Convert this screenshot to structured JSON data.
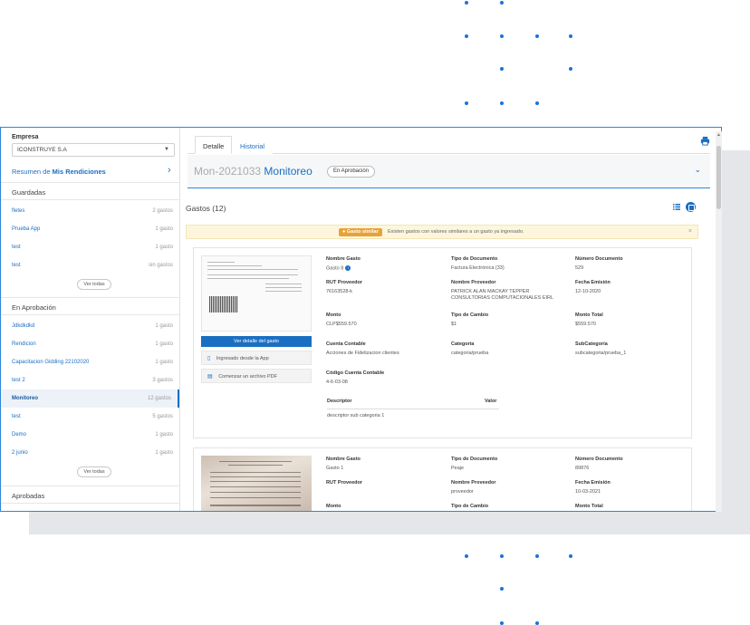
{
  "sidebar": {
    "company_label": "Empresa",
    "company_value": "ICONSTRUYE S.A",
    "resumen_prefix": "Resumen de",
    "resumen_bold": "Mis Rendiciones",
    "sections": {
      "guardadas": "Guardadas",
      "en_aprobacion": "En Aprobación",
      "aprobadas": "Aprobadas"
    },
    "guardadas_items": [
      {
        "name": "fletes",
        "count": "2 gastos"
      },
      {
        "name": "Prueba App",
        "count": "1 gasto"
      },
      {
        "name": "test",
        "count": "1 gasto"
      },
      {
        "name": "test",
        "count": "sin gastos"
      }
    ],
    "aprobacion_items": [
      {
        "name": "Jdkdkdkd",
        "count": "1 gasto"
      },
      {
        "name": "Rendicion",
        "count": "1 gasto"
      },
      {
        "name": "Capacitacion Gidding 22102020",
        "count": "1 gasto"
      },
      {
        "name": "test 2",
        "count": "3 gastos"
      },
      {
        "name": "Monitoreo",
        "count": "12 gastos"
      },
      {
        "name": "test",
        "count": "5 gastos"
      },
      {
        "name": "Demo",
        "count": "1 gasto"
      },
      {
        "name": "2 junio",
        "count": "1 gasto"
      }
    ],
    "ver_todas": "Ver todas"
  },
  "main": {
    "tabs": [
      {
        "label": "Detalle"
      },
      {
        "label": "Historial"
      }
    ],
    "rend_id": "Mon-2021033",
    "rend_name": "Monitoreo",
    "status": "En Aprobación",
    "gastos_title": "Gastos (12)",
    "alert_badge": "Gasto similar",
    "alert_text": "Existen gastos con valores similares a un gasto ya ingresado."
  },
  "card1": {
    "btn_detalle": "Ver detalle del gasto",
    "opt_app": "Ingresado desde la App",
    "opt_pdf": "Comenzar un archivo PDF",
    "nombre_gasto_lbl": "Nombre Gasto",
    "nombre_gasto": "Gasto 8",
    "tipo_doc_lbl": "Tipo de Documento",
    "tipo_doc": "Factura Electrónica (33)",
    "num_doc_lbl": "Número Documento",
    "num_doc": "529",
    "rut_lbl": "RUT Proveedor",
    "rut": "76163528-k",
    "nombre_prov_lbl": "Nombre Proveedor",
    "nombre_prov": "PATRICK ALAN MACKAY TEPPER\nCONSULTORIAS COMPUTACIONALES EIRL",
    "fecha_lbl": "Fecha Emisión",
    "fecha": "12-10-2020",
    "monto_lbl": "Monto",
    "monto": "CLP$559.570",
    "tipo_cambio_lbl": "Tipo de Cambio",
    "tipo_cambio": "$1",
    "monto_total_lbl": "Monto Total",
    "monto_total": "$559.570",
    "cuenta_lbl": "Cuenta Contable",
    "cuenta": "Acciones de Fidelizacion clientes",
    "categoria_lbl": "Categoría",
    "categoria": "categoria/prueba",
    "subcat_lbl": "SubCategoría",
    "subcat": "subcategoria/prueba_1",
    "codigo_lbl": "Código Cuenta Contable",
    "codigo": "4-6-03-08",
    "desc_head": "Descriptor",
    "valor_head": "Valor",
    "desc_row": "descriptor sub categoria 1"
  },
  "card2": {
    "nombre_gasto_lbl": "Nombre Gasto",
    "nombre_gasto": "Gasto 1",
    "tipo_doc_lbl": "Tipo de Documento",
    "tipo_doc": "Peaje",
    "num_doc_lbl": "Número Documento",
    "num_doc": "89876",
    "rut_lbl": "RUT Proveedor",
    "rut": "",
    "nombre_prov_lbl": "Nombre Proveedor",
    "nombre_prov": "proveedor",
    "fecha_lbl": "Fecha Emisión",
    "fecha": "10-03-2021",
    "monto_lbl": "Monto",
    "tipo_cambio_lbl": "Tipo de Cambio",
    "monto_total_lbl": "Monto Total"
  },
  "colors": {
    "accent": "#1a6fc2",
    "warning": "#e8a23a",
    "dots": "#1a73d9"
  }
}
